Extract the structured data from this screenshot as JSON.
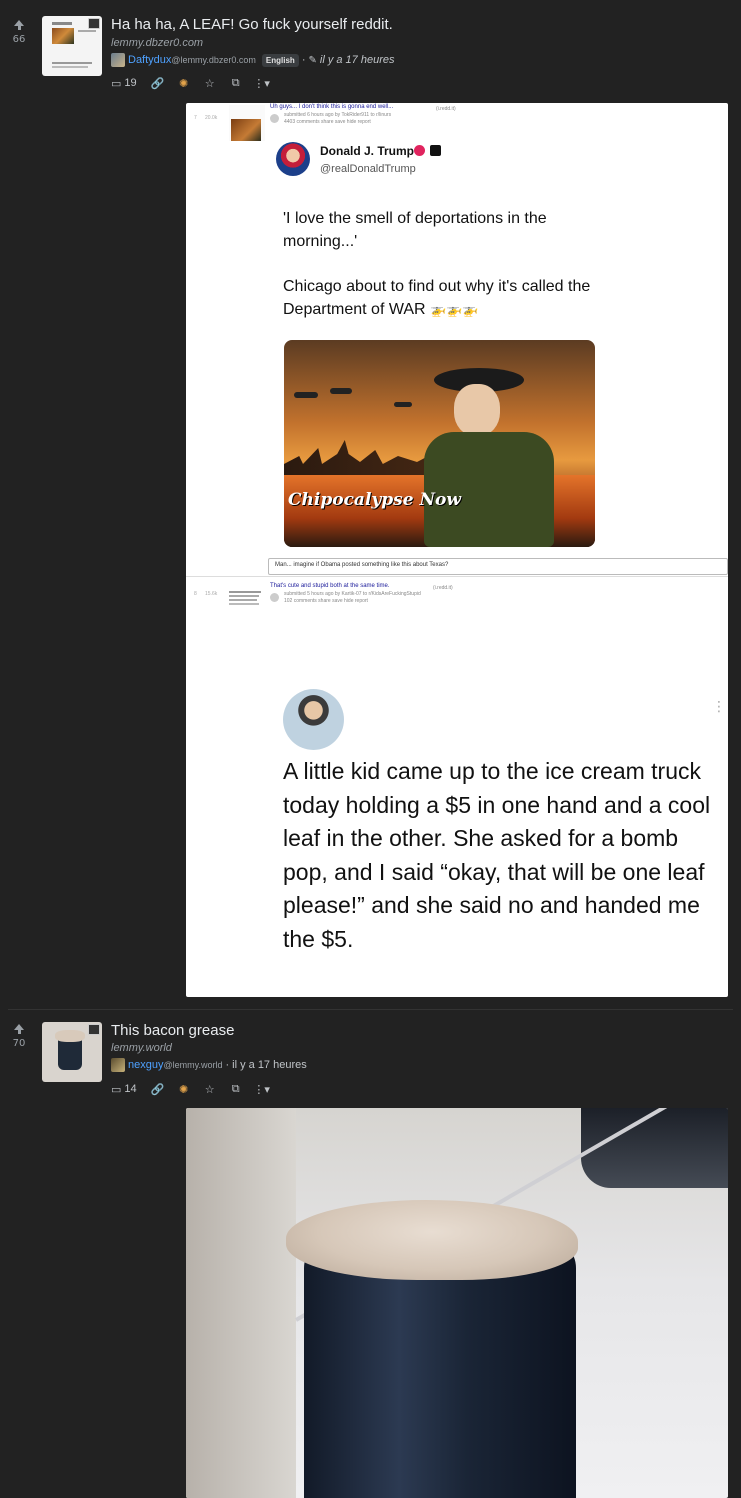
{
  "posts": [
    {
      "score": "66",
      "title": "Ha ha ha, A LEAF! Go fuck yourself reddit.",
      "domain": "lemmy.dbzer0.com",
      "user": "Daftydux",
      "instance": "@lemmy.dbzer0.com",
      "language": "English",
      "time": "il y a 17 heures",
      "comments": "19",
      "embed": {
        "post1": {
          "rank": "7",
          "votes": "20.0k",
          "title": "Uh guys... I don't think this is gonna end well...",
          "title_domain": "(i.redd.it)",
          "submitted": "submitted 6 hours ago by TokRider911  to r/linurs",
          "links": "4403 comments   share   save   hide   report",
          "tweet": {
            "name": "Donald J. Trump",
            "handle": "@realDonaldTrump",
            "line1": "'I love the smell of deportations in the morning...'",
            "line2": "Chicago about to find out why it's called the Department of WAR",
            "helicopters": "🚁🚁🚁",
            "image_caption": "Chipocalypse Now"
          },
          "comment": "Man... imagine if Obama posted something like this about Texas?"
        },
        "post2": {
          "rank": "8",
          "votes": "15.6k",
          "title": "That's cute and stupid both at the same time.",
          "title_domain": "(i.redd.it)",
          "submitted": "submitted 5 hours ago by Kartik-07  to r/KidsAreFuckingStupid",
          "links": "102 comments   share   save   hide   report",
          "text": "A little kid came up to the ice cream truck today holding a $5 in one hand and a cool leaf in the other. She asked for a bomb pop, and I said “okay, that will be one leaf please!” and she said no and handed me the $5."
        }
      }
    },
    {
      "score": "70",
      "title": "This bacon grease",
      "domain": "lemmy.world",
      "user": "nexguy",
      "instance": "@lemmy.world",
      "time": "il y a 17 heures",
      "comments": "14"
    }
  ],
  "colors": {
    "background": "#222222",
    "username": "#4ea1ff",
    "muted": "#9aa0a6"
  },
  "icons": [
    "upvote-icon",
    "image-icon",
    "comment-icon",
    "link-icon",
    "cross-post-icon",
    "star-icon",
    "copy-icon",
    "more-icon",
    "edit-icon"
  ]
}
